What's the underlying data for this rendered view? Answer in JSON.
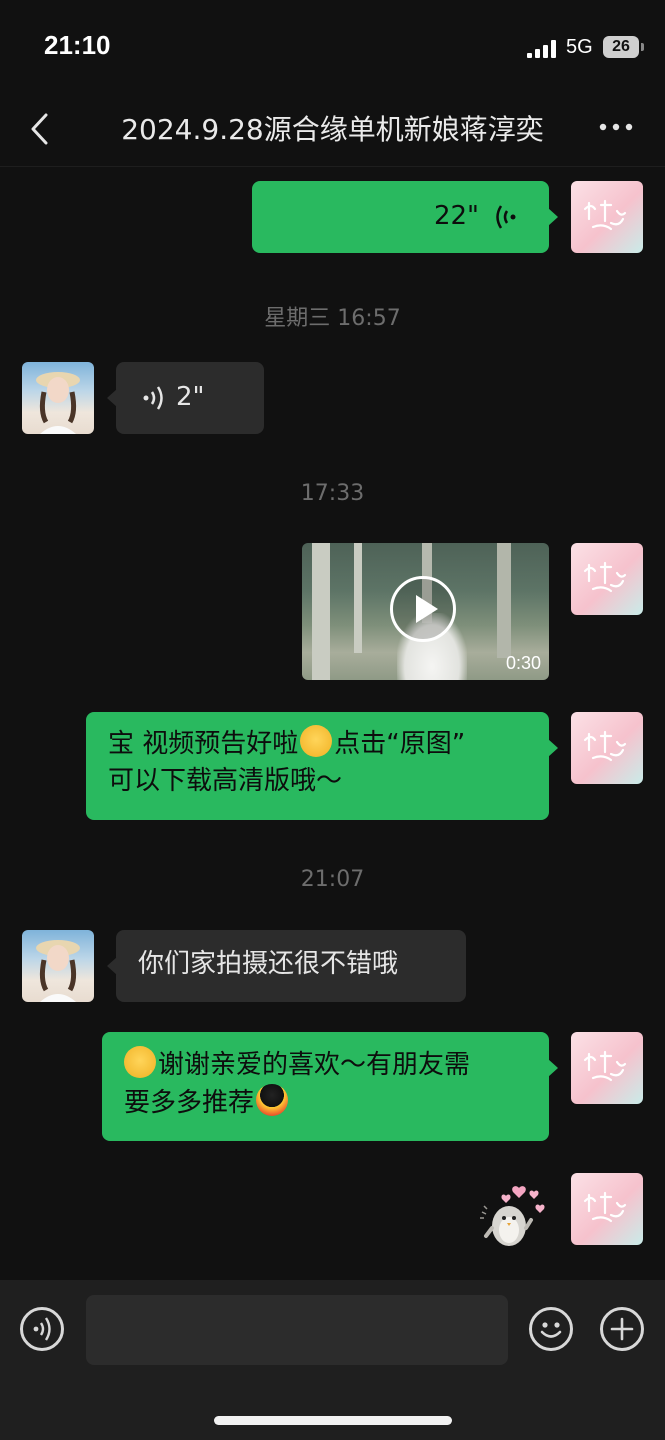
{
  "status_bar": {
    "time": "21:10",
    "network": "5G",
    "battery": "26"
  },
  "header": {
    "title": "2024.9.28源合缘单机新娘蒋淳奕"
  },
  "messages": [
    {
      "side": "right",
      "type": "voice",
      "duration": "22\""
    },
    {
      "type": "timestamp",
      "text": "星期三 16:57"
    },
    {
      "side": "left",
      "type": "voice",
      "duration": "2\""
    },
    {
      "type": "timestamp",
      "text": "17:33"
    },
    {
      "side": "right",
      "type": "video",
      "duration": "0:30"
    },
    {
      "side": "right",
      "type": "text",
      "line1": "宝 视频预告好啦",
      "line1b": "点击“原图”",
      "line2": "可以下载高清版哦～"
    },
    {
      "type": "timestamp",
      "text": "21:07"
    },
    {
      "side": "left",
      "type": "text",
      "text": "你们家拍摄还很不错哦"
    },
    {
      "side": "right",
      "type": "text",
      "line1": "谢谢亲爱的喜欢～有朋友需",
      "line2": "要多多推荐"
    },
    {
      "side": "right",
      "type": "sticker"
    }
  ],
  "icons": {
    "back": "chevron-left-icon",
    "more": "more-dots-icon",
    "voice": "voice-wave-icon",
    "emoji": "emoji-smile-icon",
    "plus": "plus-circle-icon",
    "play": "play-icon"
  },
  "colors": {
    "bubble_self": "#29b95f",
    "bubble_other": "#2c2c2c",
    "background": "#111111"
  }
}
